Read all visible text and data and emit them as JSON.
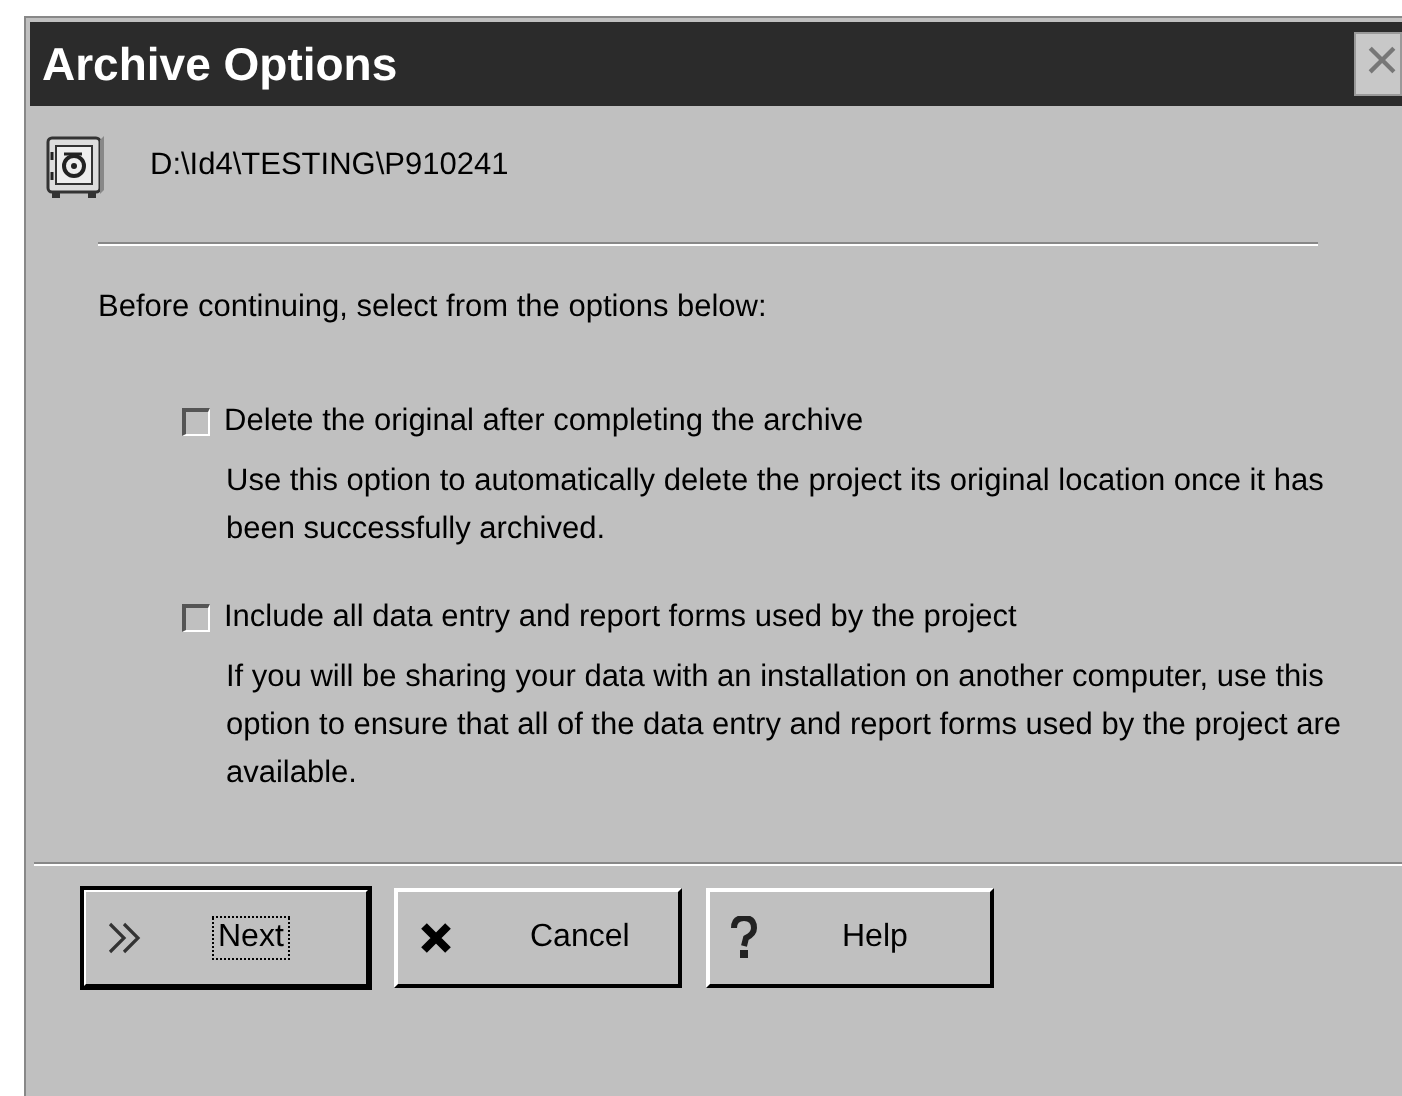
{
  "window": {
    "title": "Archive Options",
    "close_label": "×"
  },
  "path": "D:\\Id4\\TESTING\\P910241",
  "instruction": "Before continuing, select from the options below:",
  "options": [
    {
      "label": "Delete the original after completing the archive",
      "checked": false,
      "description": "Use this option to automatically delete the project its original location once it has been successfully archived."
    },
    {
      "label": "Include all data entry and report forms used by the project",
      "checked": false,
      "description": "If you will be sharing your data with an installation on another computer, use this option to ensure that all of the data entry and report forms used by the project are available."
    }
  ],
  "buttons": [
    {
      "kind": "next",
      "label": "Next",
      "default": true
    },
    {
      "kind": "cancel",
      "label": "Cancel",
      "default": false
    },
    {
      "kind": "help",
      "label": "Help",
      "default": false
    }
  ]
}
